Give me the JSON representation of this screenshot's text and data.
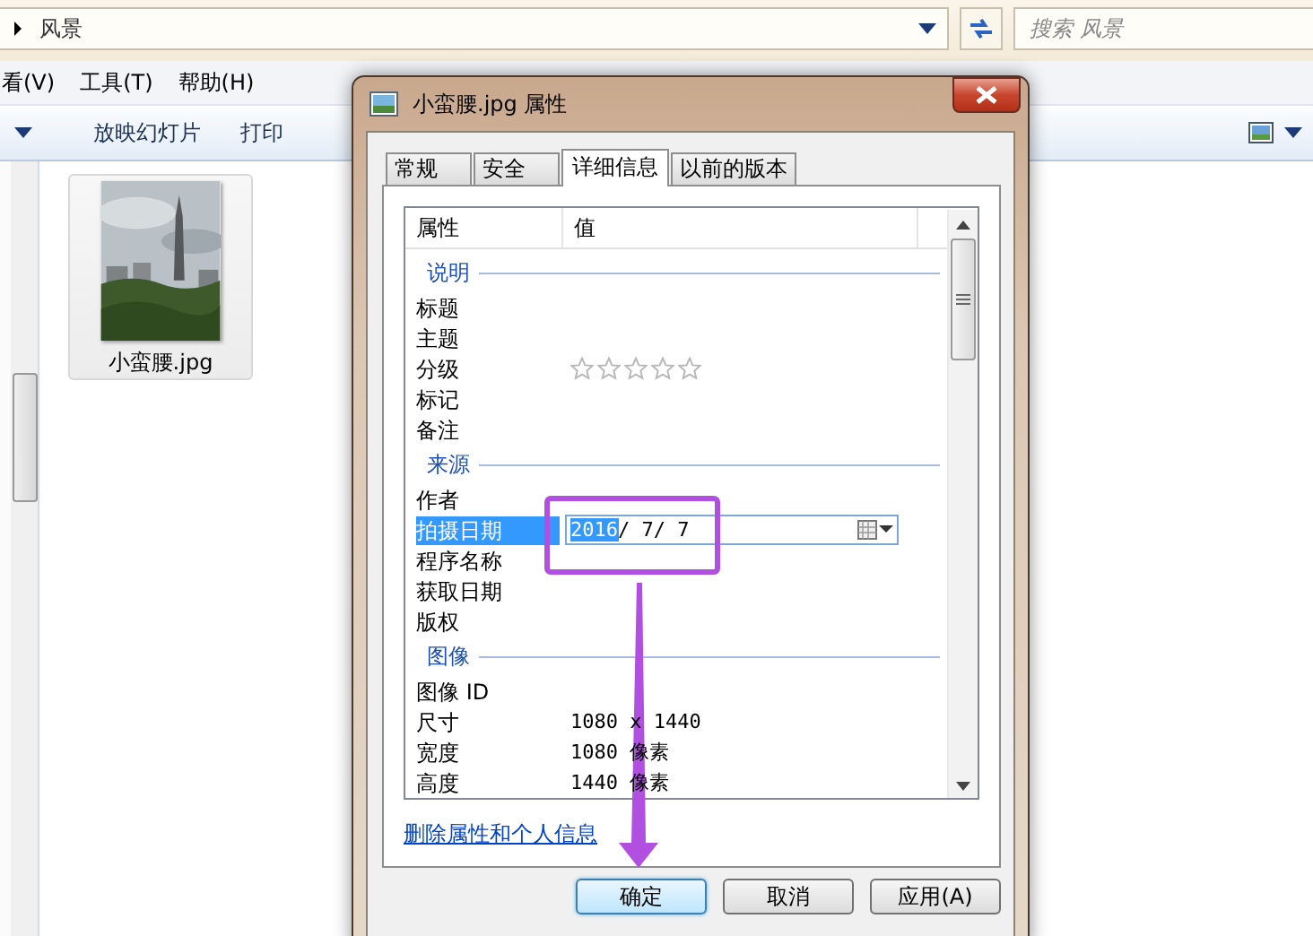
{
  "explorer": {
    "address": {
      "path": "风景"
    },
    "search": {
      "placeholder": "搜索 风景"
    },
    "menu": [
      "看(V)",
      "工具(T)",
      "帮助(H)"
    ],
    "toolbar": [
      "放映幻灯片",
      "打印"
    ],
    "files": [
      {
        "name": "小蛮腰.jpg",
        "kind": "picture"
      }
    ]
  },
  "dialog": {
    "title": "小蛮腰.jpg 属性",
    "tabs": [
      {
        "label": "常规",
        "selected": false
      },
      {
        "label": "安全",
        "selected": false
      },
      {
        "label": "详细信息",
        "selected": true
      },
      {
        "label": "以前的版本",
        "selected": false
      }
    ],
    "columns": [
      "属性",
      "值"
    ],
    "groups": [
      {
        "title": "说明",
        "rows": [
          {
            "name": "标题",
            "kind": "text",
            "selected": false
          },
          {
            "name": "主题",
            "kind": "text",
            "selected": false
          },
          {
            "name": "分级",
            "kind": "stars",
            "stars": 0,
            "selected": false
          },
          {
            "name": "标记",
            "kind": "text",
            "selected": false
          },
          {
            "name": "备注",
            "kind": "text",
            "selected": false
          }
        ]
      },
      {
        "title": "来源",
        "rows": [
          {
            "name": "作者",
            "kind": "text",
            "selected": false
          },
          {
            "name": "拍摄日期",
            "kind": "date",
            "value_selected": "2016",
            "value_rest": "/ 7/ 7",
            "selected": true
          },
          {
            "name": "程序名称",
            "kind": "text",
            "selected": false
          },
          {
            "name": "获取日期",
            "kind": "text",
            "selected": false
          },
          {
            "name": "版权",
            "kind": "text",
            "selected": false
          }
        ]
      },
      {
        "title": "图像",
        "rows": [
          {
            "name": "图像 ID",
            "kind": "text",
            "selected": false
          },
          {
            "name": "尺寸",
            "kind": "text",
            "value": "1080 x 1440",
            "selected": false
          },
          {
            "name": "宽度",
            "kind": "text",
            "value": "1080 像素",
            "selected": false
          },
          {
            "name": "高度",
            "kind": "text",
            "value": "1440 像素",
            "selected": false
          }
        ]
      }
    ],
    "link": "删除属性和个人信息",
    "buttons": [
      {
        "label": "确定",
        "default": true
      },
      {
        "label": "取消",
        "default": false
      },
      {
        "label": "应用(A)",
        "default": false
      }
    ]
  }
}
